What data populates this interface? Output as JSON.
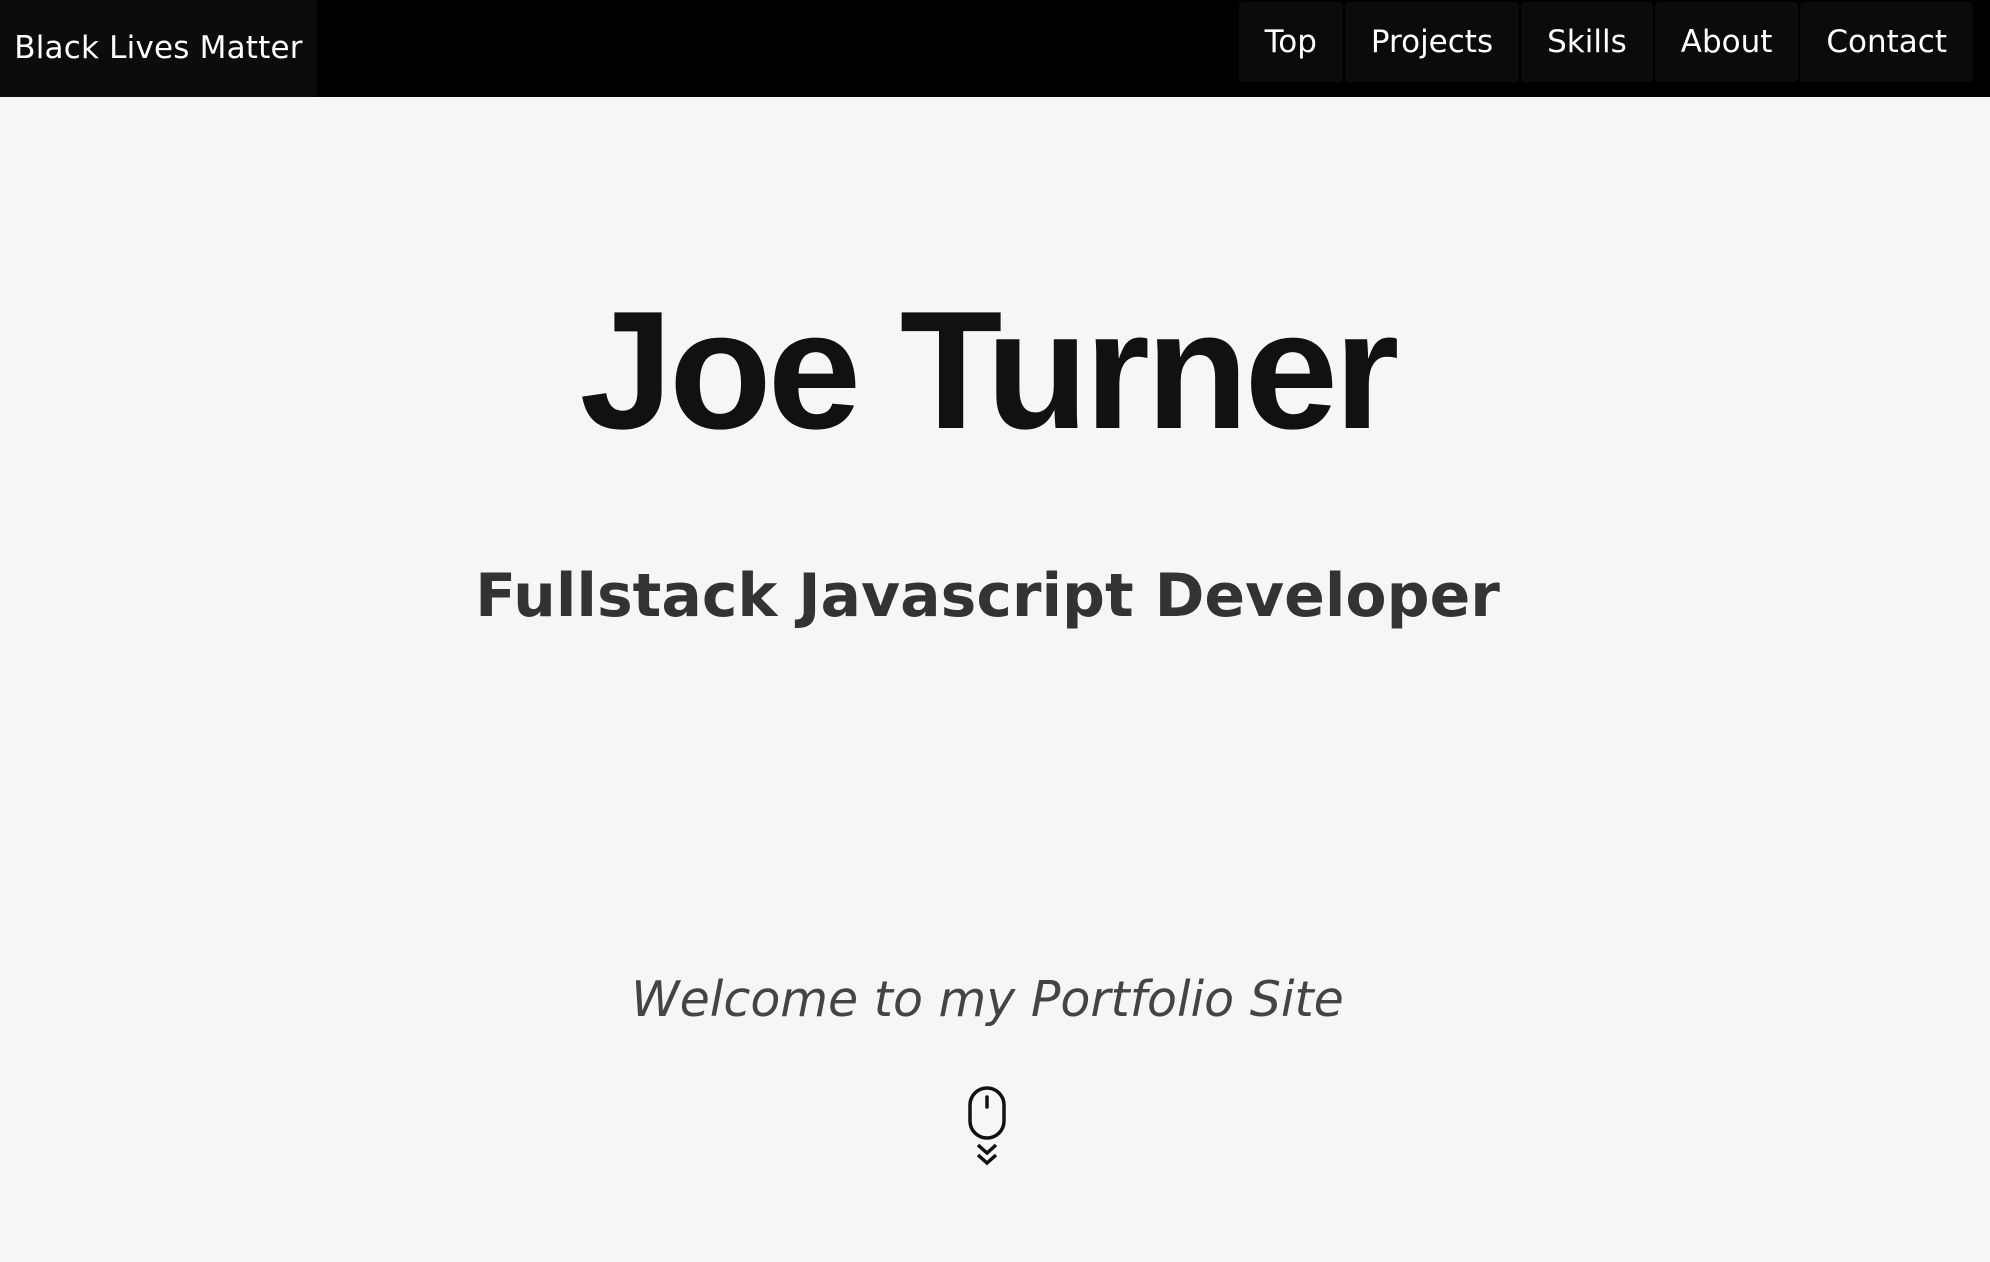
{
  "navbar": {
    "brand": "Black Lives Matter",
    "links": [
      {
        "label": "Top"
      },
      {
        "label": "Projects"
      },
      {
        "label": "Skills"
      },
      {
        "label": "About"
      },
      {
        "label": "Contact"
      }
    ]
  },
  "hero": {
    "name": "Joe Turner",
    "subtitle": "Fullstack Javascript Developer",
    "welcome": "Welcome to my Portfolio Site",
    "scroll_icon": "mouse-scroll-down-icon"
  },
  "colors": {
    "navbar_bg": "#000000",
    "page_bg": "#f6f6f6",
    "title_text": "#111111",
    "subtitle_text": "#333333"
  }
}
